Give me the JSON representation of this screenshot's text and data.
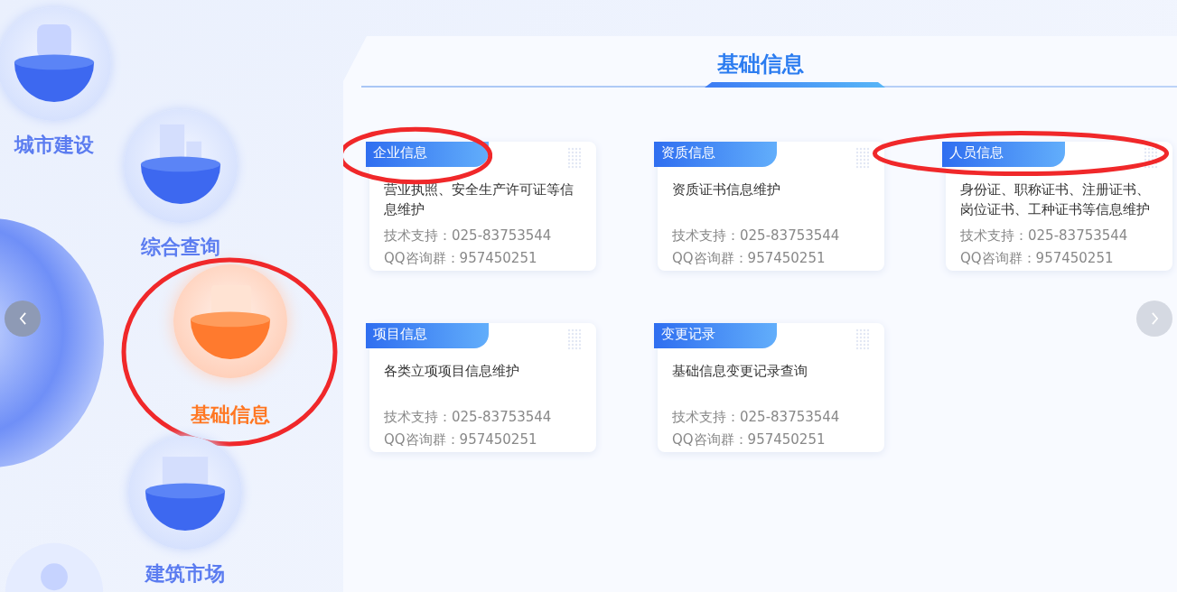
{
  "nav": [
    {
      "label": "城市建设",
      "selected": false,
      "highlighted": false
    },
    {
      "label": "综合查询",
      "selected": false,
      "highlighted": false
    },
    {
      "label": "基础信息",
      "selected": true,
      "highlighted": true
    },
    {
      "label": "建筑市场",
      "selected": false,
      "highlighted": false
    }
  ],
  "panel": {
    "title": "基础信息"
  },
  "cards": [
    {
      "title": "企业信息",
      "description": "营业执照、安全生产许可证等信息维护",
      "support": "技术支持：025-83753544",
      "qq": "QQ咨询群：957450251",
      "highlighted": true
    },
    {
      "title": "资质信息",
      "description": "资质证书信息维护",
      "support": "技术支持：025-83753544",
      "qq": "QQ咨询群：957450251",
      "highlighted": false
    },
    {
      "title": "人员信息",
      "description": "身份证、职称证书、注册证书、岗位证书、工种证书等信息维护",
      "support": "技术支持：025-83753544",
      "qq": "QQ咨询群：957450251",
      "highlighted": true
    },
    {
      "title": "项目信息",
      "description": "各类立项项目信息维护",
      "support": "技术支持：025-83753544",
      "qq": "QQ咨询群：957450251",
      "highlighted": false
    },
    {
      "title": "变更记录",
      "description": "基础信息变更记录查询",
      "support": "技术支持：025-83753544",
      "qq": "QQ咨询群：957450251",
      "highlighted": false
    }
  ]
}
